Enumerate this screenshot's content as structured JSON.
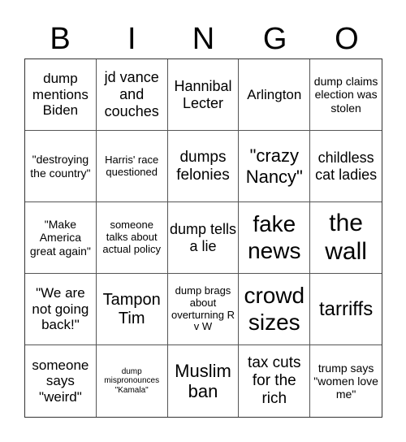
{
  "header": {
    "letters": [
      "B",
      "I",
      "N",
      "G",
      "O"
    ]
  },
  "cells": [
    [
      "dump mentions Biden",
      "jd vance and couches",
      "Hannibal Lecter",
      "Arlington",
      "dump claims election was stolen"
    ],
    [
      "\"destroying the country\"",
      "Harris' race questioned",
      "dumps felonies",
      "\"crazy Nancy\"",
      "childless cat ladies"
    ],
    [
      "\"Make America great again\"",
      "someone talks about actual policy",
      "dump tells a lie",
      "fake news",
      "the wall"
    ],
    [
      "\"We are not going back!\"",
      "Tampon Tim",
      "dump brags about overturning R v W",
      "crowd sizes",
      "tarriffs"
    ],
    [
      "someone says \"weird\"",
      "dump mispronounces \"Kamala\"",
      "Muslim ban",
      "tax cuts for the rich",
      "trump says \"women love me\""
    ]
  ]
}
